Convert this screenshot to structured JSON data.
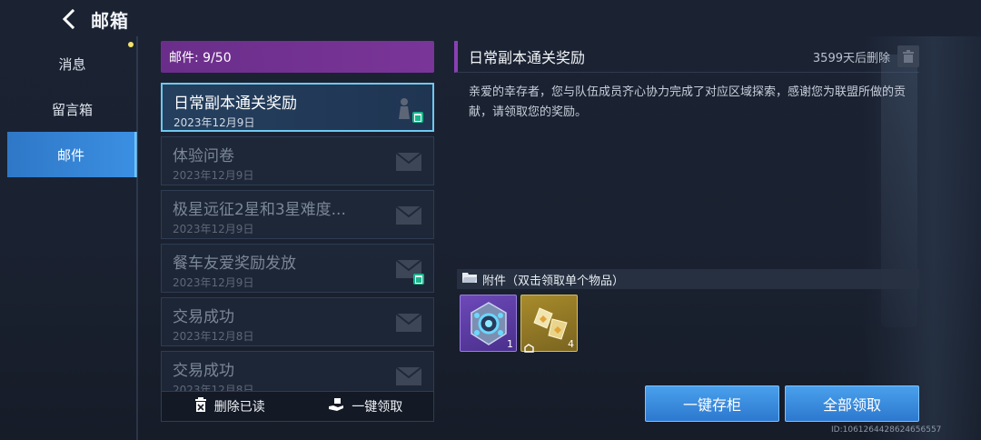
{
  "header": {
    "title": "邮箱"
  },
  "sidebar": {
    "items": [
      {
        "label": "消息"
      },
      {
        "label": "留言箱"
      },
      {
        "label": "邮件"
      }
    ]
  },
  "mail_list": {
    "count_label": "邮件: 9/50",
    "items": [
      {
        "title": "日常副本通关奖励",
        "date": "2023年12月9日",
        "selected": true
      },
      {
        "title": "体验问卷",
        "date": "2023年12月9日"
      },
      {
        "title": "极星远征2星和3星难度...",
        "date": "2023年12月9日"
      },
      {
        "title": "餐车友爱奖励发放",
        "date": "2023年12月9日"
      },
      {
        "title": "交易成功",
        "date": "2023年12月8日"
      },
      {
        "title": "交易成功",
        "date": "2023年12月8日"
      }
    ],
    "delete_read_label": "删除已读",
    "claim_all_label": "一键领取"
  },
  "detail": {
    "title": "日常副本通关奖励",
    "expire_text": "3599天后删除",
    "body": "亲爱的幸存者，您与队伍成员齐心协力完成了对应区域探索，感谢您为联盟所做的贡献，请领取您的奖励。",
    "attachments_label": "附件（双击领取单个物品）",
    "attachments": [
      {
        "count": "1",
        "rarity": "purple"
      },
      {
        "count": "4",
        "rarity": "gold"
      }
    ],
    "store_all_label": "一键存柜",
    "claim_all_label": "全部领取"
  },
  "footer": {
    "uid": "ID:1061264428624656557"
  },
  "colors": {
    "accent_blue": "#3b8fe2",
    "accent_purple": "#7a3598",
    "badge_green": "#19b48c"
  }
}
